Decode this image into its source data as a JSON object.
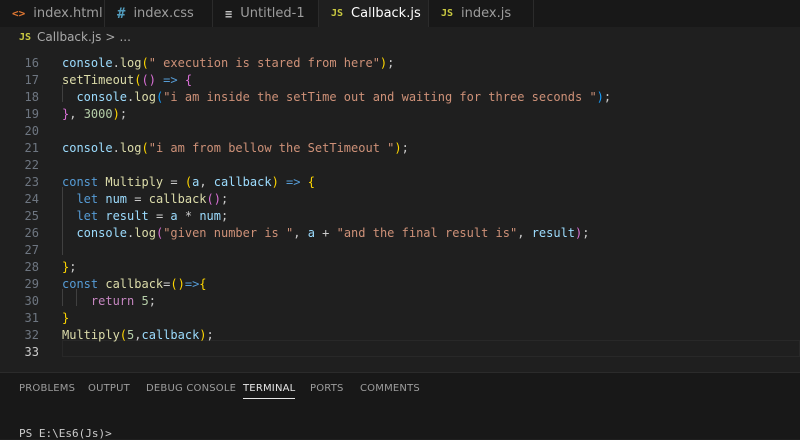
{
  "tabs": [
    {
      "label": "index.html",
      "icon": "html-file-icon",
      "glyph": "<>"
    },
    {
      "label": "index.css",
      "icon": "css-file-icon",
      "glyph": "#"
    },
    {
      "label": "Untitled-1",
      "icon": "text-file-icon",
      "glyph": "≡"
    },
    {
      "label": "Callback.js",
      "icon": "js-file-icon",
      "glyph": "JS"
    },
    {
      "label": "index.js",
      "icon": "js-file-icon",
      "glyph": "JS"
    }
  ],
  "breadcrumb": {
    "file": "Callback.js",
    "separator": ">",
    "rest": "..."
  },
  "code_lines": [
    {
      "num": "16",
      "tokens": [
        {
          "t": "console",
          "c": "#9cdcfe"
        },
        {
          "t": ".",
          "c": "#cccccc"
        },
        {
          "t": "log",
          "c": "#dcdcaa"
        },
        {
          "t": "(",
          "c": "#ffd700"
        },
        {
          "t": "\" execution is stared from here\"",
          "c": "#ce9178"
        },
        {
          "t": ")",
          "c": "#ffd700"
        },
        {
          "t": ";",
          "c": "#cccccc"
        }
      ]
    },
    {
      "num": "17",
      "tokens": [
        {
          "t": "setTimeout",
          "c": "#dcdcaa"
        },
        {
          "t": "(",
          "c": "#ffd700"
        },
        {
          "t": "()",
          "c": "#da70d6"
        },
        {
          "t": " => ",
          "c": "#569cd6"
        },
        {
          "t": "{",
          "c": "#da70d6"
        }
      ]
    },
    {
      "num": "18",
      "tokens": [
        {
          "t": "  ",
          "c": "#cccccc"
        },
        {
          "t": "console",
          "c": "#9cdcfe"
        },
        {
          "t": ".",
          "c": "#cccccc"
        },
        {
          "t": "log",
          "c": "#dcdcaa"
        },
        {
          "t": "(",
          "c": "#179fff"
        },
        {
          "t": "\"i am inside the setTime out and waiting for three seconds \"",
          "c": "#ce9178"
        },
        {
          "t": ")",
          "c": "#179fff"
        },
        {
          "t": ";",
          "c": "#cccccc"
        }
      ]
    },
    {
      "num": "19",
      "tokens": [
        {
          "t": "}",
          "c": "#da70d6"
        },
        {
          "t": ", ",
          "c": "#cccccc"
        },
        {
          "t": "3000",
          "c": "#b5cea8"
        },
        {
          "t": ")",
          "c": "#ffd700"
        },
        {
          "t": ";",
          "c": "#cccccc"
        }
      ]
    },
    {
      "num": "20",
      "tokens": []
    },
    {
      "num": "21",
      "tokens": [
        {
          "t": "console",
          "c": "#9cdcfe"
        },
        {
          "t": ".",
          "c": "#cccccc"
        },
        {
          "t": "log",
          "c": "#dcdcaa"
        },
        {
          "t": "(",
          "c": "#ffd700"
        },
        {
          "t": "\"i am from bellow the SetTimeout \"",
          "c": "#ce9178"
        },
        {
          "t": ")",
          "c": "#ffd700"
        },
        {
          "t": ";",
          "c": "#cccccc"
        }
      ]
    },
    {
      "num": "22",
      "tokens": []
    },
    {
      "num": "23",
      "tokens": [
        {
          "t": "const ",
          "c": "#569cd6"
        },
        {
          "t": "Multiply",
          "c": "#dcdcaa"
        },
        {
          "t": " = ",
          "c": "#cccccc"
        },
        {
          "t": "(",
          "c": "#ffd700"
        },
        {
          "t": "a",
          "c": "#9cdcfe"
        },
        {
          "t": ", ",
          "c": "#cccccc"
        },
        {
          "t": "callback",
          "c": "#9cdcfe"
        },
        {
          "t": ")",
          "c": "#ffd700"
        },
        {
          "t": " => ",
          "c": "#569cd6"
        },
        {
          "t": "{",
          "c": "#ffd700"
        }
      ]
    },
    {
      "num": "24",
      "tokens": [
        {
          "t": "  ",
          "c": "#cccccc"
        },
        {
          "t": "let ",
          "c": "#569cd6"
        },
        {
          "t": "num",
          "c": "#9cdcfe"
        },
        {
          "t": " = ",
          "c": "#cccccc"
        },
        {
          "t": "callback",
          "c": "#dcdcaa"
        },
        {
          "t": "()",
          "c": "#da70d6"
        },
        {
          "t": ";",
          "c": "#cccccc"
        }
      ]
    },
    {
      "num": "25",
      "tokens": [
        {
          "t": "  ",
          "c": "#cccccc"
        },
        {
          "t": "let ",
          "c": "#569cd6"
        },
        {
          "t": "result",
          "c": "#9cdcfe"
        },
        {
          "t": " = ",
          "c": "#cccccc"
        },
        {
          "t": "a",
          "c": "#9cdcfe"
        },
        {
          "t": " * ",
          "c": "#cccccc"
        },
        {
          "t": "num",
          "c": "#9cdcfe"
        },
        {
          "t": ";",
          "c": "#cccccc"
        }
      ]
    },
    {
      "num": "26",
      "tokens": [
        {
          "t": "  ",
          "c": "#cccccc"
        },
        {
          "t": "console",
          "c": "#9cdcfe"
        },
        {
          "t": ".",
          "c": "#cccccc"
        },
        {
          "t": "log",
          "c": "#dcdcaa"
        },
        {
          "t": "(",
          "c": "#da70d6"
        },
        {
          "t": "\"given number is \"",
          "c": "#ce9178"
        },
        {
          "t": ", ",
          "c": "#cccccc"
        },
        {
          "t": "a",
          "c": "#9cdcfe"
        },
        {
          "t": " + ",
          "c": "#cccccc"
        },
        {
          "t": "\"and the final result is\"",
          "c": "#ce9178"
        },
        {
          "t": ", ",
          "c": "#cccccc"
        },
        {
          "t": "result",
          "c": "#9cdcfe"
        },
        {
          "t": ")",
          "c": "#da70d6"
        },
        {
          "t": ";",
          "c": "#cccccc"
        }
      ]
    },
    {
      "num": "27",
      "tokens": []
    },
    {
      "num": "28",
      "tokens": [
        {
          "t": "}",
          "c": "#ffd700"
        },
        {
          "t": ";",
          "c": "#cccccc"
        }
      ]
    },
    {
      "num": "29",
      "tokens": [
        {
          "t": "const ",
          "c": "#569cd6"
        },
        {
          "t": "callback",
          "c": "#dcdcaa"
        },
        {
          "t": "=",
          "c": "#cccccc"
        },
        {
          "t": "()",
          "c": "#ffd700"
        },
        {
          "t": "=>",
          "c": "#569cd6"
        },
        {
          "t": "{",
          "c": "#ffd700"
        }
      ]
    },
    {
      "num": "30",
      "tokens": [
        {
          "t": "    ",
          "c": "#cccccc"
        },
        {
          "t": "return ",
          "c": "#c586c0"
        },
        {
          "t": "5",
          "c": "#b5cea8"
        },
        {
          "t": ";",
          "c": "#cccccc"
        }
      ]
    },
    {
      "num": "31",
      "tokens": [
        {
          "t": "}",
          "c": "#ffd700"
        }
      ]
    },
    {
      "num": "32",
      "tokens": [
        {
          "t": "Multiply",
          "c": "#dcdcaa"
        },
        {
          "t": "(",
          "c": "#ffd700"
        },
        {
          "t": "5",
          "c": "#b5cea8"
        },
        {
          "t": ",",
          "c": "#cccccc"
        },
        {
          "t": "callback",
          "c": "#9cdcfe"
        },
        {
          "t": ")",
          "c": "#ffd700"
        },
        {
          "t": ";",
          "c": "#cccccc"
        }
      ]
    },
    {
      "num": "33",
      "tokens": []
    }
  ],
  "panel_tabs": [
    "PROBLEMS",
    "OUTPUT",
    "DEBUG CONSOLE",
    "TERMINAL",
    "PORTS",
    "COMMENTS"
  ],
  "terminal": {
    "prompt": "PS E:\\Es6(Js)>"
  }
}
